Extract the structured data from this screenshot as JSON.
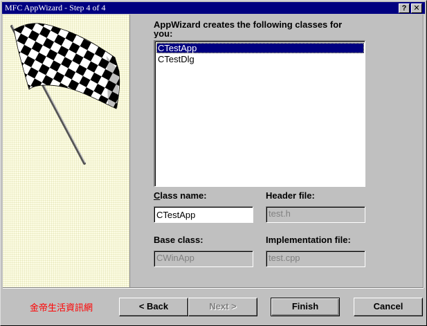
{
  "window": {
    "title": "MFC AppWizard - Step 4 of 4",
    "help_label": "?",
    "close_label": "✕"
  },
  "prompt": "AppWizard creates the following classes for you:",
  "class_list": [
    {
      "label": "CTestApp",
      "selected": true
    },
    {
      "label": "CTestDlg",
      "selected": false
    }
  ],
  "fields": {
    "class_name": {
      "label": "Class name:",
      "value": "CTestApp"
    },
    "header_file": {
      "label": "Header file:",
      "value": "test.h"
    },
    "base_class": {
      "label": "Base class:",
      "value": "CWinApp"
    },
    "implementation_file": {
      "label": "Implementation file:",
      "value": "test.cpp"
    }
  },
  "footer": {
    "watermark": "金帝生活資訊網"
  },
  "buttons": {
    "back": "< Back",
    "next": "Next >",
    "finish": "Finish",
    "cancel": "Cancel"
  },
  "colors": {
    "titlebar": "#000080",
    "selection": "#000080",
    "face": "#c0c0c0",
    "watermark": "#ff0000"
  },
  "icons": {
    "illustration": "checkered-flag-icon"
  }
}
